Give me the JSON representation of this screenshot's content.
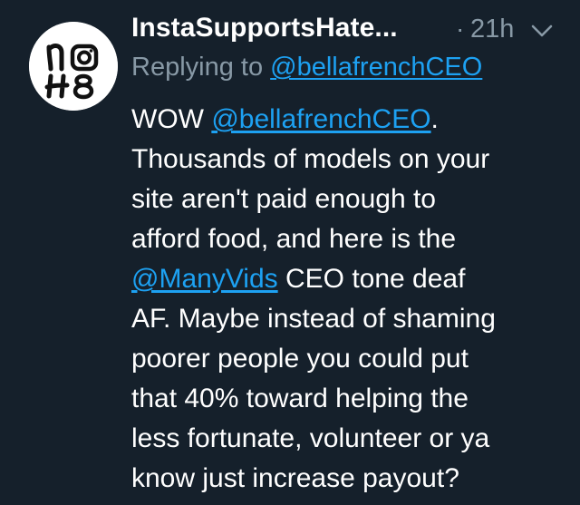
{
  "tweet": {
    "display_name": "InstaSupportsHate...",
    "separator": "·",
    "timestamp": "21h",
    "menu_icon": "chevron-down-icon",
    "avatar_text_top": "no",
    "avatar_text_bottom": "H8",
    "reply_prefix": "Replying to ",
    "reply_handle": "@bellafrenchCEO",
    "body": {
      "line1_text": "WOW ",
      "line1_mention": "@bellafrenchCEO",
      "line1_end": ".",
      "line2": "Thousands of models on your",
      "line3": "site aren't paid enough to",
      "line4": "afford food, and here is the",
      "line5_mention": "@ManyVids",
      "line5_text": " CEO tone deaf",
      "line6": "AF. Maybe instead of shaming",
      "line7": "poorer people you could put",
      "line8": "that 40% toward helping the",
      "line9": "less fortunate, volunteer or ya",
      "line10": "know just increase payout?"
    }
  },
  "colors": {
    "background": "#15202b",
    "primary_text": "#ffffff",
    "secondary_text": "#8899a6",
    "link": "#1da1f2"
  }
}
